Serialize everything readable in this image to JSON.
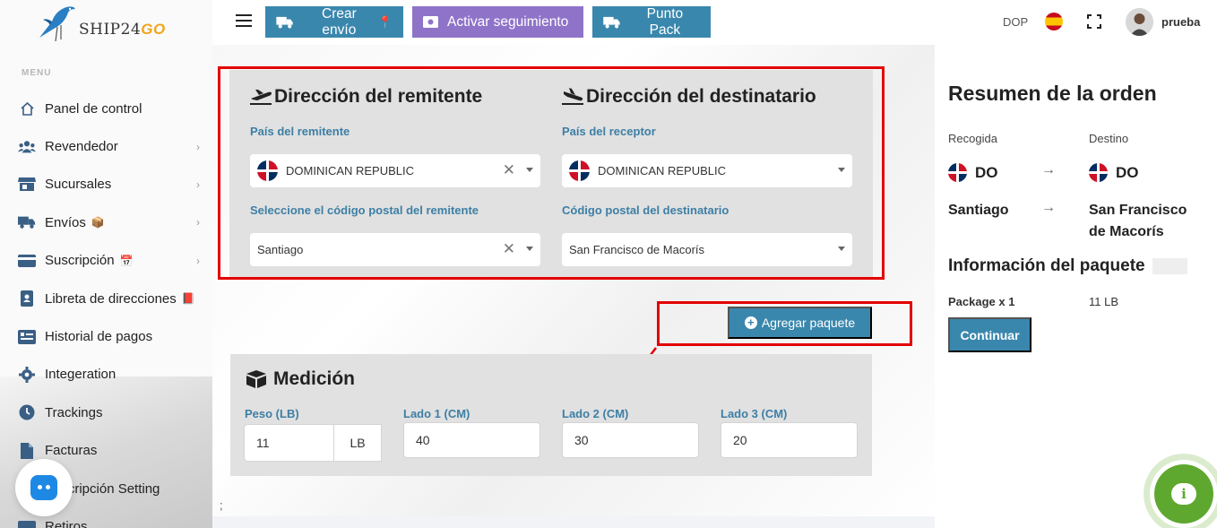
{
  "app": {
    "logo_text": "SHIP24",
    "logo_accent": "GO",
    "accent_color": "#3a87ad"
  },
  "header": {
    "create_label": "Crear envío",
    "track_label": "Activar seguimiento",
    "pack_label": "Punto Pack",
    "currency": "DOP",
    "language_icon": "spain-flag-icon",
    "username": "prueba"
  },
  "sidebar": {
    "menu_label": "MENU",
    "items": [
      {
        "label": "Panel de control",
        "icon": "home-icon",
        "chevron": false
      },
      {
        "label": "Revendedor",
        "icon": "users-icon",
        "chevron": true
      },
      {
        "label": "Sucursales",
        "icon": "store-icon",
        "chevron": true
      },
      {
        "label": "Envíos",
        "icon": "truck-icon",
        "chevron": true,
        "emoji": "📦"
      },
      {
        "label": "Suscripción",
        "icon": "card-icon",
        "chevron": true,
        "emoji": "📅"
      },
      {
        "label": "Libreta de direcciones",
        "icon": "address-book-icon",
        "chevron": false,
        "emoji": "📕"
      },
      {
        "label": "Historial de pagos",
        "icon": "history-icon",
        "chevron": false
      },
      {
        "label": "Integeration",
        "icon": "gear-icon",
        "chevron": false
      },
      {
        "label": "Trackings",
        "icon": "clock-icon",
        "chevron": false
      },
      {
        "label": "Facturas",
        "icon": "file-icon",
        "chevron": false
      },
      {
        "label": "Suscripción Setting",
        "icon": "settings-icon",
        "chevron": false
      },
      {
        "label": "Retiros",
        "icon": "wallet-icon",
        "chevron": false
      }
    ]
  },
  "sender": {
    "title": "Dirección del remitente",
    "country_label": "País del remitente",
    "country_value": "DOMINICAN REPUBLIC",
    "postal_label": "Seleccione el código postal del remitente",
    "postal_value": "Santiago"
  },
  "recipient": {
    "title": "Dirección del destinatario",
    "country_label": "País del receptor",
    "country_value": "DOMINICAN REPUBLIC",
    "postal_label": "Código postal del destinatario",
    "postal_value": "San Francisco de Macorís"
  },
  "add_package_label": "Agregar paquete",
  "measurement": {
    "title": "Medición",
    "weight_label": "Peso (LB)",
    "weight_value": "11",
    "weight_unit": "LB",
    "side1_label": "Lado 1 (CM)",
    "side1_value": "40",
    "side2_label": "Lado 2 (CM)",
    "side2_value": "30",
    "side3_label": "Lado 3 (CM)",
    "side3_value": "20"
  },
  "footer_text": ";",
  "summary": {
    "title": "Resumen de la orden",
    "pickup_label": "Recogida",
    "destination_label": "Destino",
    "pickup_code": "DO",
    "destination_code": "DO",
    "pickup_city": "Santiago",
    "destination_city": "San Francisco de Macorís",
    "package_title": "Información del paquete",
    "package_line": "Package x 1",
    "package_weight": "11 LB",
    "continue_label": "Continuar"
  }
}
